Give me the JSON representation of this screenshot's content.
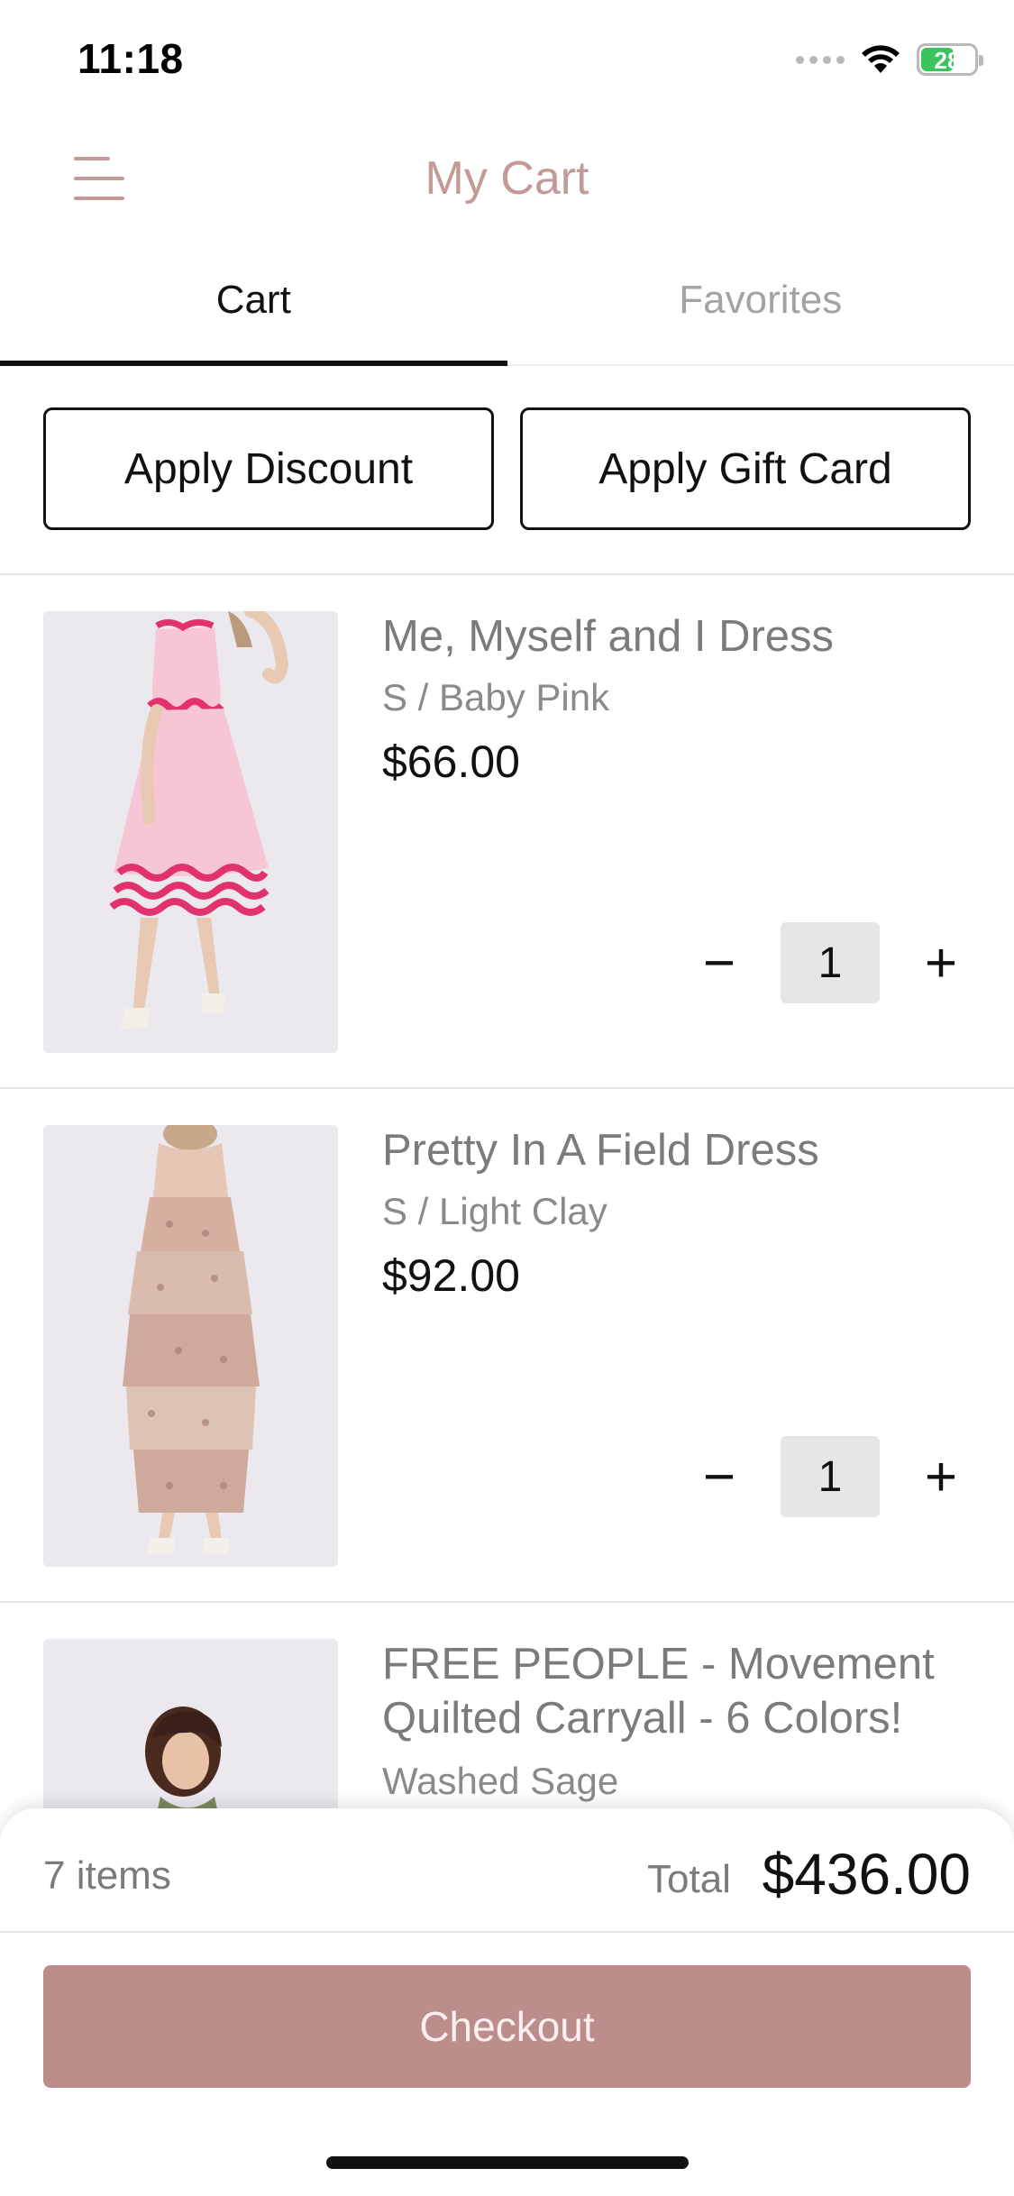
{
  "status_bar": {
    "time": "11:18",
    "battery": "28"
  },
  "header": {
    "title": "My Cart"
  },
  "tabs": [
    {
      "label": "Cart",
      "active": true
    },
    {
      "label": "Favorites",
      "active": false
    }
  ],
  "actions": {
    "discount_label": "Apply Discount",
    "gift_card_label": "Apply Gift Card"
  },
  "items": [
    {
      "name": "Me, Myself and I Dress",
      "variant": "S / Baby Pink",
      "price": "$66.00",
      "quantity": "1",
      "image": "pink-dress-photo"
    },
    {
      "name": "Pretty In A Field Dress",
      "variant": "S / Light Clay",
      "price": "$92.00",
      "quantity": "1",
      "image": "floral-dress-photo"
    },
    {
      "name": "FREE PEOPLE - Movement Quilted Carryall - 6 Colors!",
      "variant": "Washed Sage",
      "image": "carryall-photo"
    }
  ],
  "qty_controls": {
    "minus": "−",
    "plus": "+"
  },
  "summary": {
    "item_count": "7 items",
    "total_label": "Total",
    "total_value": "$436.00"
  },
  "checkout": {
    "label": "Checkout"
  },
  "colors": {
    "accent": "#c49a98",
    "checkout_bg": "#bb8e8c",
    "text": "#111111",
    "muted": "#7b7b7b"
  }
}
